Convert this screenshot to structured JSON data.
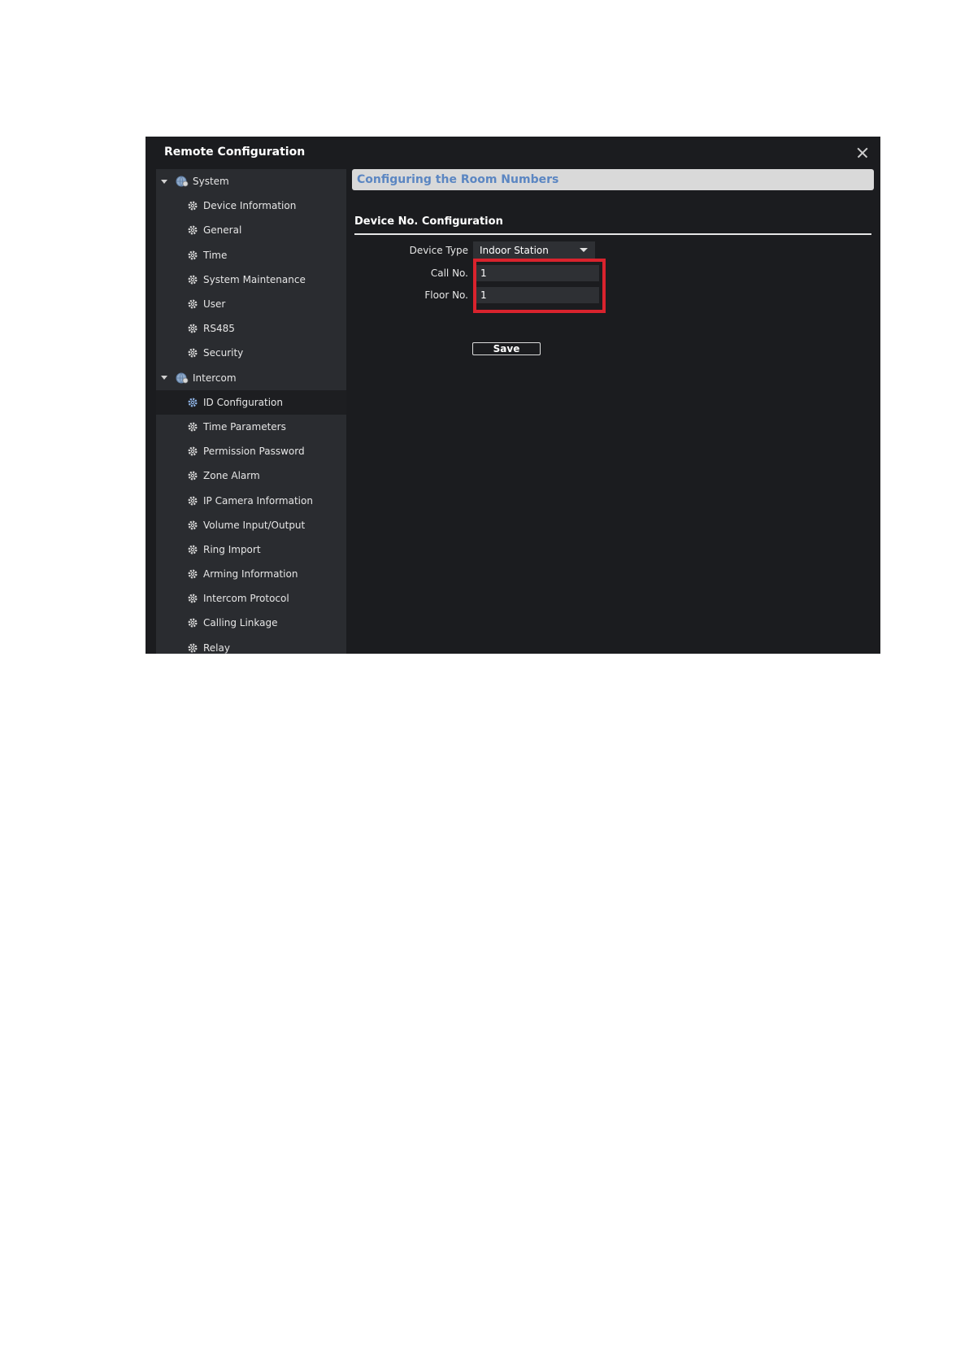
{
  "window": {
    "title": "Remote Configuration",
    "close_icon": "close-icon"
  },
  "sidebar": {
    "groups": [
      {
        "label": "System",
        "icon": "globe-gear-icon",
        "items": [
          {
            "label": "Device Information"
          },
          {
            "label": "General"
          },
          {
            "label": "Time"
          },
          {
            "label": "System Maintenance"
          },
          {
            "label": "User"
          },
          {
            "label": "RS485"
          },
          {
            "label": "Security"
          }
        ]
      },
      {
        "label": "Intercom",
        "icon": "globe-gear-icon",
        "items": [
          {
            "label": "ID Configuration",
            "selected": true
          },
          {
            "label": "Time Parameters"
          },
          {
            "label": "Permission Password"
          },
          {
            "label": "Zone Alarm"
          },
          {
            "label": "IP Camera Information"
          },
          {
            "label": "Volume Input/Output"
          },
          {
            "label": "Ring Import"
          },
          {
            "label": "Arming Information"
          },
          {
            "label": "Intercom Protocol"
          },
          {
            "label": "Calling Linkage"
          },
          {
            "label": "Relay"
          }
        ]
      }
    ]
  },
  "main": {
    "header": "Configuring the Room Numbers",
    "section_title": "Device No. Configuration",
    "device_type": {
      "label": "Device Type",
      "value": "Indoor Station"
    },
    "call_no": {
      "label": "Call No.",
      "value": "1"
    },
    "floor_no": {
      "label": "Floor No.",
      "value": "1"
    },
    "save_label": "Save"
  },
  "colors": {
    "window_bg": "#1b1c1f",
    "sidebar_bg": "#2a2c30",
    "header_text": "#5b86c2",
    "highlight": "#d9232d"
  }
}
